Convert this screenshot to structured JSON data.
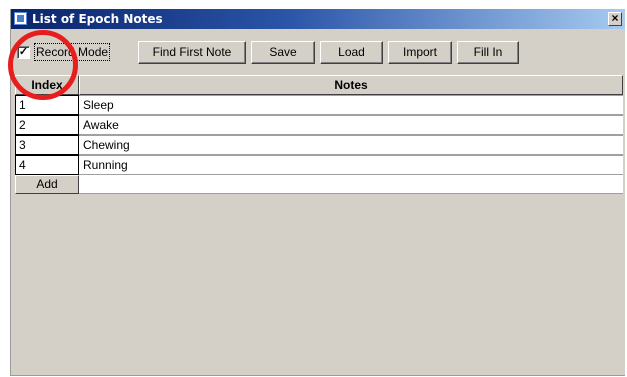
{
  "window": {
    "title": "List of Epoch Notes",
    "close_glyph": "×"
  },
  "toolbar": {
    "record_mode": {
      "label": "Record Mode",
      "checked": true,
      "check_glyph": "✓"
    },
    "buttons": [
      "Find First Note",
      "Save",
      "Load",
      "Import",
      "Fill In"
    ]
  },
  "table": {
    "headers": {
      "index": "Index",
      "notes": "Notes"
    },
    "rows": [
      {
        "index": "1",
        "note": "Sleep"
      },
      {
        "index": "2",
        "note": "Awake"
      },
      {
        "index": "3",
        "note": "Chewing"
      },
      {
        "index": "4",
        "note": "Running"
      }
    ],
    "add_label": "Add"
  },
  "colors": {
    "titlebar_start": "#0a246a",
    "titlebar_end": "#a6caf0",
    "window_bg": "#d4d0c8",
    "highlight": "#e81e1e"
  },
  "icons": [
    "app-icon",
    "close-icon",
    "checkbox-check-icon"
  ]
}
